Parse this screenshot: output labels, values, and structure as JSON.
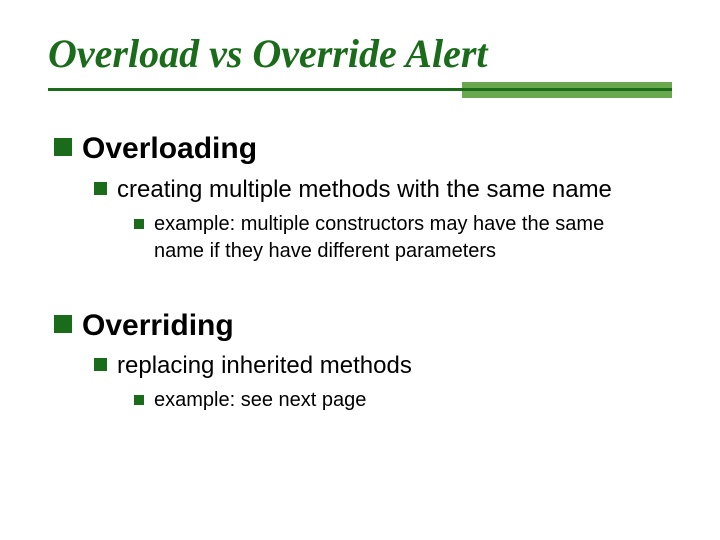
{
  "title": "Overload vs Override Alert",
  "sections": [
    {
      "heading": "Overloading",
      "sub": {
        "text": "creating multiple methods with the same name",
        "example": "example: multiple constructors may have the same name if they have different parameters"
      }
    },
    {
      "heading": "Overriding",
      "sub": {
        "text": "replacing inherited methods",
        "example": "example: see next page"
      }
    }
  ],
  "colors": {
    "primary": "#1a6b1a",
    "accent": "#6aa84f"
  }
}
